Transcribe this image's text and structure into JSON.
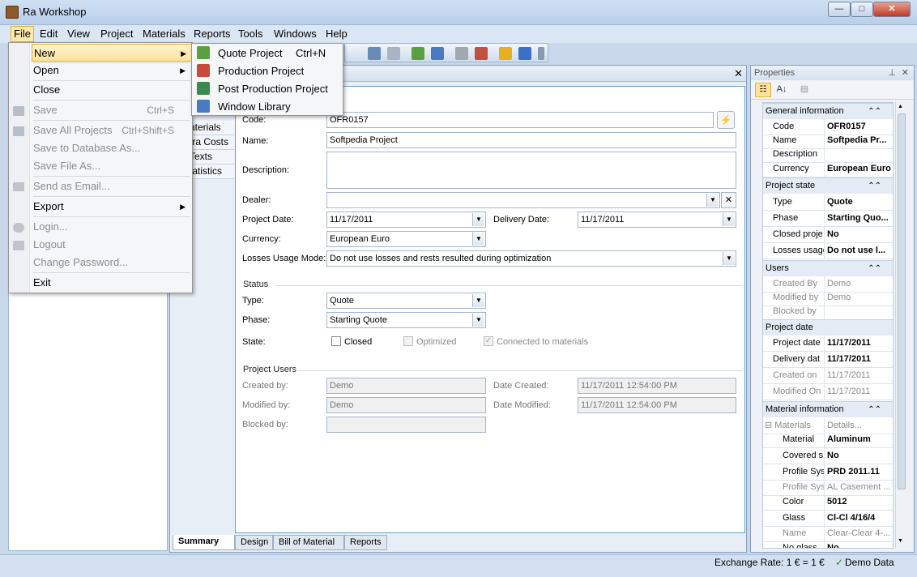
{
  "window": {
    "title": "Ra Workshop",
    "min": "—",
    "max": "□",
    "close": "✕"
  },
  "menubar": [
    "File",
    "Edit",
    "View",
    "Project",
    "Materials",
    "Reports",
    "Tools",
    "Windows",
    "Help"
  ],
  "file_menu": {
    "new": "New",
    "open": "Open",
    "close": "Close",
    "save": "Save",
    "save_sc": "Ctrl+S",
    "save_all": "Save All Projects",
    "save_all_sc": "Ctrl+Shift+S",
    "save_db": "Save to Database As...",
    "save_file": "Save File As...",
    "send_email": "Send as Email...",
    "export": "Export",
    "login": "Login...",
    "logout": "Logout",
    "change_pw": "Change Password...",
    "exit": "Exit"
  },
  "new_submenu": {
    "quote": "Quote Project",
    "quote_sc": "Ctrl+N",
    "production": "Production Project",
    "post": "Post Production Project",
    "library": "Window Library"
  },
  "doc": {
    "close": "✕",
    "nav": [
      "aterials",
      "tra Costs",
      "Texts",
      "tatistics"
    ],
    "general": {
      "code_label": "Code:",
      "code": "OFR0157",
      "name_label": "Name:",
      "name": "Softpedia Project",
      "desc_label": "Description:",
      "dealer_label": "Dealer:",
      "pdate_label": "Project Date:",
      "pdate": "11/17/2011",
      "ddate_label": "Delivery Date:",
      "ddate": "11/17/2011",
      "currency_label": "Currency:",
      "currency": "European Euro",
      "losses_label": "Losses Usage Mode:",
      "losses": "Do not use losses and rests resulted during optimization"
    },
    "status": {
      "title": "Status",
      "type_label": "Type:",
      "type": "Quote",
      "phase_label": "Phase:",
      "phase": "Starting Quote",
      "state_label": "State:",
      "closed": "Closed",
      "optimized": "Optimized",
      "connected": "Connected to materials"
    },
    "users": {
      "title": "Project Users",
      "created_label": "Created by:",
      "created": "Demo",
      "modified_label": "Modified by:",
      "modified": "Demo",
      "blocked_label": "Blocked by:",
      "dcreated_label": "Date Created:",
      "dcreated": "11/17/2011 12:54:00 PM",
      "dmodified_label": "Date Modified:",
      "dmodified": "11/17/2011 12:54:00 PM"
    },
    "tabs": [
      "Summary",
      "Design",
      "Bill of Material",
      "Reports"
    ]
  },
  "properties": {
    "title": "Properties",
    "general": {
      "title": "General information",
      "rows": [
        {
          "k": "Code",
          "v": "OFR0157"
        },
        {
          "k": "Name",
          "v": "Softpedia Pr..."
        },
        {
          "k": "Description",
          "v": ""
        },
        {
          "k": "Currency",
          "v": "European Euro"
        }
      ]
    },
    "state": {
      "title": "Project state",
      "rows": [
        {
          "k": "Type",
          "v": "Quote"
        },
        {
          "k": "Phase",
          "v": "Starting Quo..."
        },
        {
          "k": "Closed proje",
          "v": "No"
        },
        {
          "k": "Losses usage",
          "v": "Do not use l..."
        }
      ]
    },
    "users": {
      "title": "Users",
      "rows": [
        {
          "k": "Created By",
          "v": "Demo"
        },
        {
          "k": "Modified by",
          "v": "Demo"
        },
        {
          "k": "Blocked by",
          "v": ""
        }
      ]
    },
    "date": {
      "title": "Project date",
      "rows": [
        {
          "k": "Project date",
          "v": "11/17/2011"
        },
        {
          "k": "Delivery dat",
          "v": "11/17/2011"
        },
        {
          "k": "Created on",
          "v": "11/17/2011"
        },
        {
          "k": "Modified On",
          "v": "11/17/2011"
        }
      ]
    },
    "material": {
      "title": "Material information",
      "rows": [
        {
          "k": "Materials",
          "v": "Details..."
        },
        {
          "k": "Material",
          "v": "Aluminum"
        },
        {
          "k": "Covered s",
          "v": "No"
        },
        {
          "k": "Profile Sys",
          "v": "PRD 2011.11"
        },
        {
          "k": "Profile Sys",
          "v": "AL Casement ..."
        },
        {
          "k": "Color",
          "v": "5012"
        },
        {
          "k": "Glass",
          "v": "Cl-Cl 4/16/4"
        },
        {
          "k": "Name",
          "v": "Clear-Clear 4-..."
        },
        {
          "k": "No glass",
          "v": "No"
        }
      ]
    }
  },
  "status": {
    "exchange": "Exchange Rate: 1 € = 1 €",
    "data": "Demo Data"
  }
}
